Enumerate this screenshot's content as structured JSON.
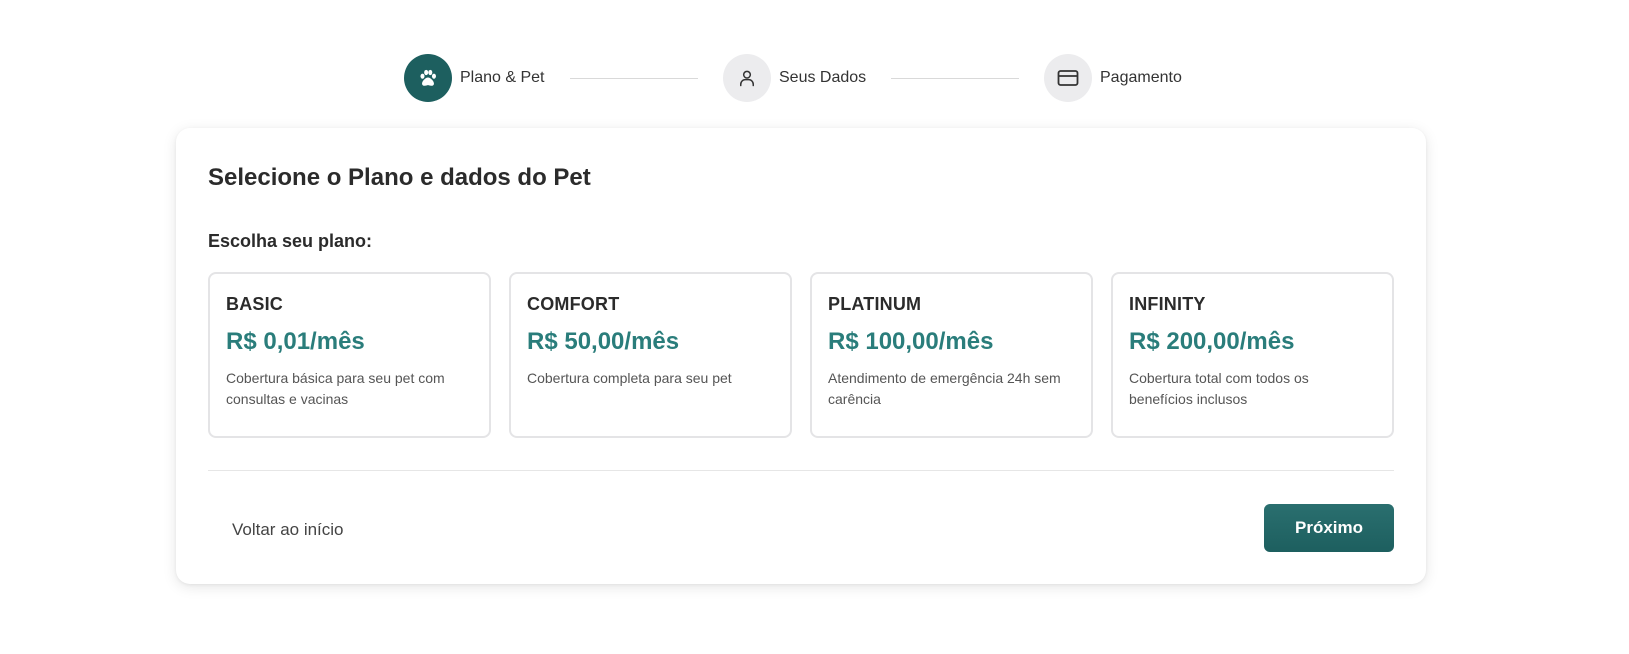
{
  "stepper": {
    "steps": [
      {
        "label": "Plano & Pet",
        "icon": "paw-icon",
        "active": true
      },
      {
        "label": "Seus Dados",
        "icon": "user-icon",
        "active": false
      },
      {
        "label": "Pagamento",
        "icon": "credit-card-icon",
        "active": false
      }
    ]
  },
  "form": {
    "title": "Selecione o Plano e dados do Pet",
    "plans_label": "Escolha seu plano:",
    "plans": [
      {
        "name": "BASIC",
        "price": "R$ 0,01/mês",
        "description": "Cobertura básica para seu pet com consultas e vacinas"
      },
      {
        "name": "COMFORT",
        "price": "R$ 50,00/mês",
        "description": "Cobertura completa para seu pet"
      },
      {
        "name": "PLATINUM",
        "price": "R$ 100,00/mês",
        "description": "Atendimento de emergência 24h sem carência"
      },
      {
        "name": "INFINITY",
        "price": "R$ 200,00/mês",
        "description": "Cobertura total com todos os benefícios inclusos"
      }
    ],
    "back_label": "Voltar ao início",
    "next_label": "Próximo"
  },
  "colors": {
    "primary": "#1d5f5f",
    "price": "#2a7d7b",
    "inactive_step": "#ececee"
  }
}
